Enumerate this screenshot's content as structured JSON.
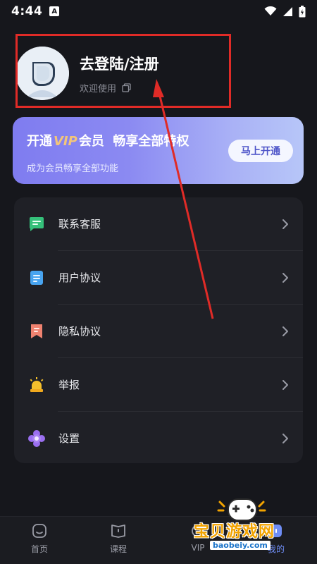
{
  "status_bar": {
    "time": "4:44",
    "notif_badge": "A"
  },
  "profile": {
    "title": "去登陆/注册",
    "subtitle": "欢迎使用"
  },
  "vip": {
    "title_prefix": "开通",
    "title_vip": "VIP",
    "title_suffix": "会员  畅享全部特权",
    "subtitle": "成为会员畅享全部功能",
    "button": "马上开通"
  },
  "menu": {
    "items": [
      {
        "label": "联系客服",
        "icon": "chat-icon"
      },
      {
        "label": "用户协议",
        "icon": "document-icon"
      },
      {
        "label": "隐私协议",
        "icon": "bookmark-icon"
      },
      {
        "label": "举报",
        "icon": "alarm-icon"
      },
      {
        "label": "设置",
        "icon": "flower-settings-icon"
      }
    ]
  },
  "bottom_nav": {
    "items": [
      {
        "label": "首页"
      },
      {
        "label": "课程"
      },
      {
        "label": "VIP"
      },
      {
        "label": "我的"
      }
    ]
  },
  "watermark": {
    "text": "宝贝游戏网",
    "domain": "baobeiy.com"
  },
  "colors": {
    "background": "#16171c",
    "card": "#1f2026",
    "accent": "#6f8df5",
    "annotation": "#e02b27"
  }
}
